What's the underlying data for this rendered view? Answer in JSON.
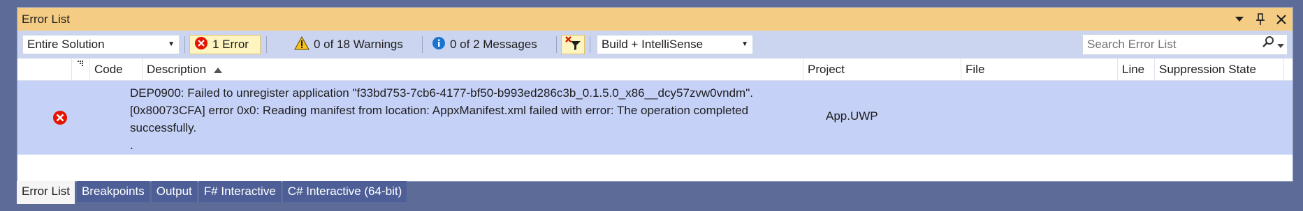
{
  "window": {
    "title": "Error List"
  },
  "toolbar": {
    "scope": "Entire Solution",
    "errors_label": "1 Error",
    "warnings_label": "0 of 18 Warnings",
    "messages_label": "0 of 2 Messages",
    "build_filter": "Build + IntelliSense",
    "search_placeholder": "Search Error List"
  },
  "columns": {
    "code": "Code",
    "description": "Description",
    "project": "Project",
    "file": "File",
    "line": "Line",
    "suppression": "Suppression State"
  },
  "rows": [
    {
      "severity": "error",
      "code": "",
      "description_line1": "DEP0900: Failed to unregister application \"f33bd753-7cb6-4177-bf50-b993ed286c3b_0.1.5.0_x86__dcy57zvw0vndm\".",
      "description_line2": "[0x80073CFA] error 0x0: Reading manifest from location: AppxManifest.xml failed with error: The operation completed",
      "description_line3": "successfully.",
      "description_line4": ".",
      "project": "App.UWP",
      "file": "",
      "line": "",
      "suppression": ""
    }
  ],
  "tabs": [
    {
      "label": "Error List",
      "active": true
    },
    {
      "label": "Breakpoints",
      "active": false
    },
    {
      "label": "Output",
      "active": false
    },
    {
      "label": "F# Interactive",
      "active": false
    },
    {
      "label": "C# Interactive (64-bit)",
      "active": false
    }
  ],
  "colors": {
    "title_bar": "#f5cc84",
    "toolbar": "#ccd5f0",
    "selected_row": "#c5d1f7",
    "error_red": "#e51400",
    "warning_yellow": "#f8c11c",
    "info_blue": "#1a75d2",
    "frame": "#5d6b99"
  }
}
